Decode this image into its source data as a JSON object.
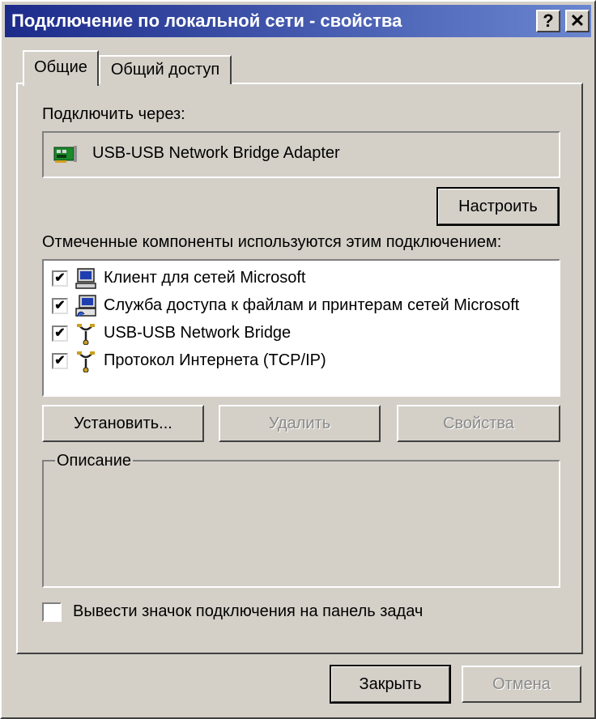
{
  "window": {
    "title": "Подключение по локальной сети - свойства",
    "help_glyph": "?",
    "close_glyph": "✕"
  },
  "tabs": [
    {
      "label": "Общие",
      "active": true
    },
    {
      "label": "Общий доступ",
      "active": false
    }
  ],
  "connect_via": {
    "label": "Подключить через:",
    "adapter": "USB-USB Network Bridge Adapter",
    "adapter_icon": "network-card-icon"
  },
  "configure_button": "Настроить",
  "components": {
    "label": "Отмеченные компоненты используются этим подключением:",
    "items": [
      {
        "label": "Клиент для сетей Microsoft",
        "checked": true,
        "icon": "computer-icon"
      },
      {
        "label": "Служба доступа к файлам и принтерам сетей Microsoft",
        "checked": true,
        "icon": "file-printer-sharing-icon"
      },
      {
        "label": "USB-USB Network Bridge",
        "checked": true,
        "icon": "protocol-icon"
      },
      {
        "label": "Протокол Интернета (TCP/IP)",
        "checked": true,
        "icon": "protocol-icon"
      }
    ]
  },
  "component_buttons": {
    "install": "Установить...",
    "uninstall": "Удалить",
    "properties": "Свойства"
  },
  "description": {
    "legend": "Описание",
    "text": ""
  },
  "show_icon": {
    "label": "Вывести значок подключения на панель задач",
    "checked": false
  },
  "footer": {
    "close": "Закрыть",
    "cancel": "Отмена"
  },
  "colors": {
    "titlebar_start": "#1c2b8a",
    "titlebar_end": "#6a86d0",
    "dialog_face": "#d4d0c8"
  }
}
